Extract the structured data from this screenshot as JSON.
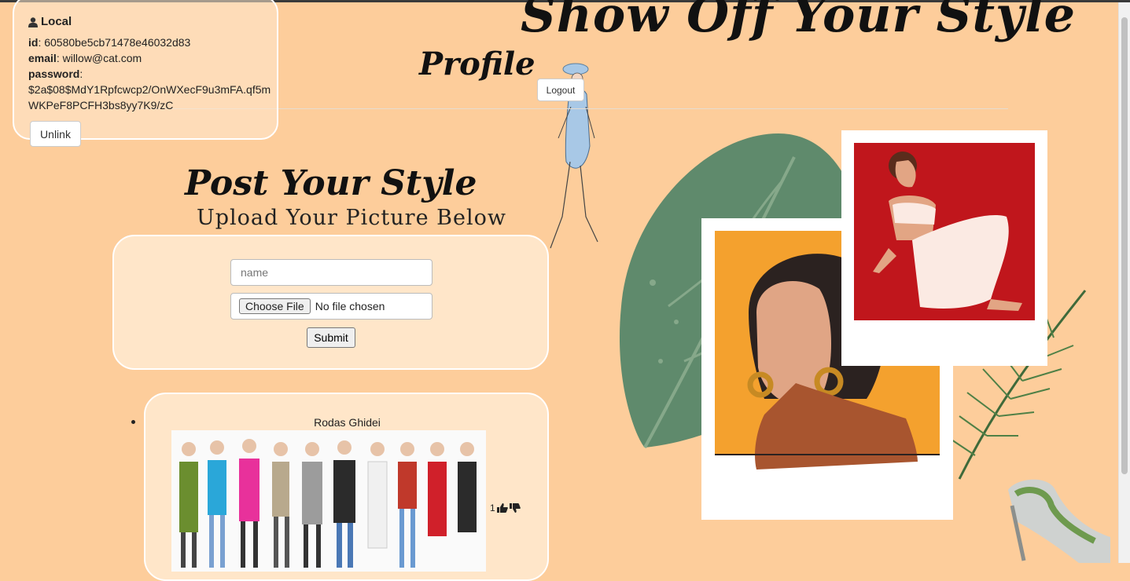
{
  "site_title": "Show Off Your Style",
  "profile_title": "Profile",
  "logout_label": "Logout",
  "local": {
    "heading": "Local",
    "id_label": "id",
    "id_value": "60580be5cb71478e46032d83",
    "email_label": "email",
    "email_value": "willow@cat.com",
    "password_label": "password",
    "password_value": "$2a$08$MdY1Rpfcwcp2/OnWXecF9u3mFA.qf5mWKPeF8PCFH3bs8yy7K9/zC",
    "unlink_label": "Unlink"
  },
  "post_section": {
    "title": "Post Your Style",
    "subtitle": "Upload Your Picture Below",
    "name_placeholder": "name",
    "file_button": "Choose File",
    "file_status": "No file chosen",
    "submit_label": "Submit"
  },
  "posts": [
    {
      "author": "Rodas Ghidei",
      "likes": "1"
    }
  ],
  "colors": {
    "background": "#fdcd9b",
    "card": "#ffe6c9",
    "leaf": "#5f8a6c",
    "orange_panel": "#f4a12e",
    "red_panel": "#c0161c",
    "skin": "#e2a584",
    "shirt": "#a8552f"
  },
  "icons": [
    "user-icon",
    "thumbs-up-icon",
    "thumbs-down-icon"
  ]
}
